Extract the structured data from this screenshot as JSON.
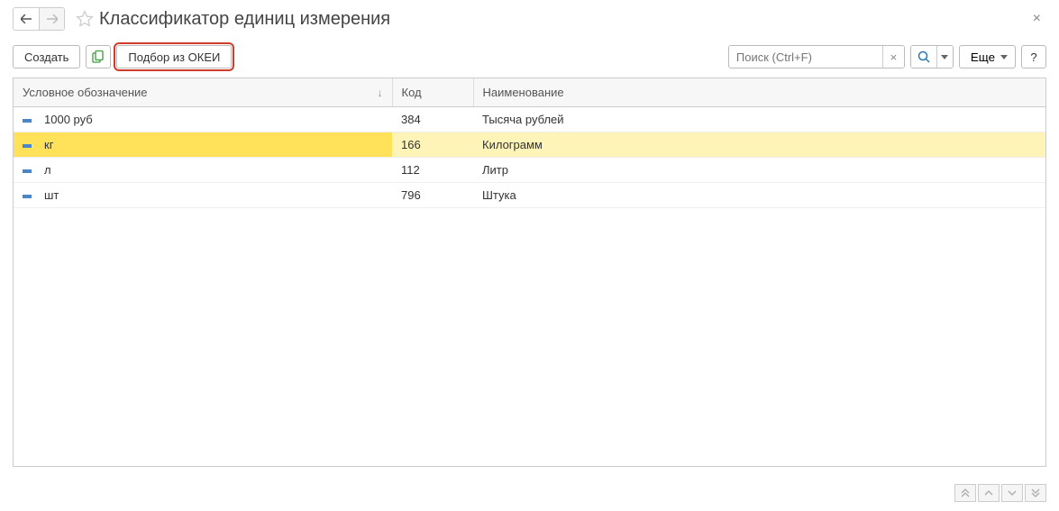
{
  "header": {
    "title": "Классификатор единиц измерения"
  },
  "toolbar": {
    "create_label": "Создать",
    "pick_okei_label": "Подбор из ОКЕИ",
    "more_label": "Еще",
    "help_label": "?"
  },
  "search": {
    "placeholder": "Поиск (Ctrl+F)",
    "clear_label": "×"
  },
  "table": {
    "columns": {
      "symbol": "Условное обозначение",
      "code": "Код",
      "name": "Наименование"
    },
    "rows": [
      {
        "symbol": "1000 руб",
        "code": "384",
        "name": "Тысяча рублей",
        "selected": false
      },
      {
        "symbol": "кг",
        "code": "166",
        "name": "Килограмм",
        "selected": true
      },
      {
        "symbol": "л",
        "code": "112",
        "name": "Литр",
        "selected": false
      },
      {
        "symbol": "шт",
        "code": "796",
        "name": "Штука",
        "selected": false
      }
    ]
  },
  "close_label": "×"
}
